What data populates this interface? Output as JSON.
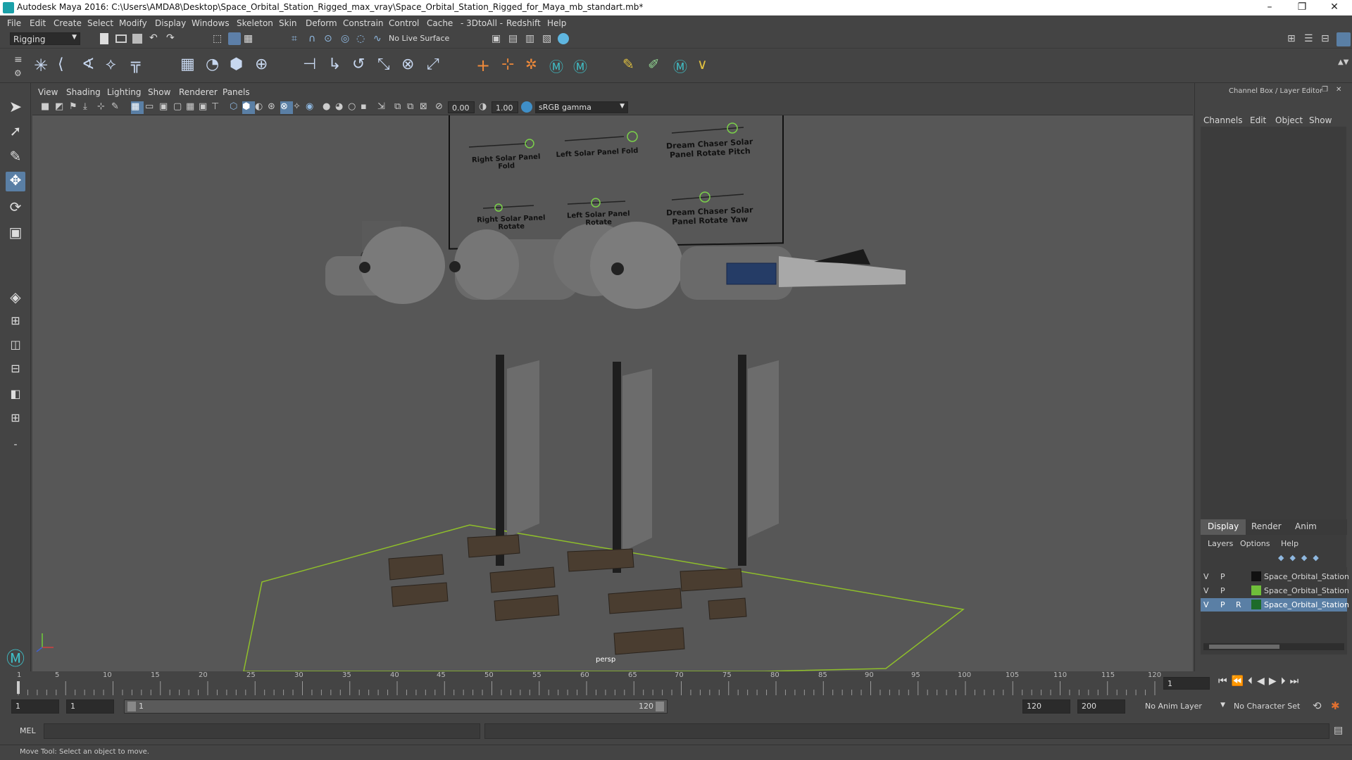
{
  "window": {
    "title": "Autodesk Maya 2016: C:\\Users\\AMDA8\\Desktop\\Space_Orbital_Station_Rigged_max_vray\\Space_Orbital_Station_Rigged_for_Maya_mb_standart.mb*",
    "minimize": "–",
    "restore": "❐",
    "close": "✕"
  },
  "menubar": [
    "File",
    "Edit",
    "Create",
    "Select",
    "Modify",
    "Display",
    "Windows",
    "Skeleton",
    "Skin",
    "Deform",
    "Constrain",
    "Control",
    "Cache",
    "- 3DtoAll -",
    "Redshift",
    "Help"
  ],
  "statusline": {
    "mode": "Rigging",
    "live_surface": "No Live Surface"
  },
  "panel": {
    "menus": [
      "View",
      "Shading",
      "Lighting",
      "Show",
      "Renderer",
      "Panels"
    ],
    "exposure": "0.00",
    "gamma": "1.00",
    "colorspace": "sRGB gamma",
    "camera_label": "persp"
  },
  "controls": {
    "labels": [
      "Right Solar Panel Fold",
      "Left Solar Panel Fold",
      "Dream Chaser Solar Panel Rotate Pitch",
      "Right Solar Panel Rotate",
      "Left Solar Panel Rotate",
      "Dream Chaser Solar Panel Rotate Yaw"
    ]
  },
  "channelbox": {
    "header": "Channel Box / Layer Editor",
    "menus": [
      "Channels",
      "Edit",
      "Object",
      "Show"
    ],
    "tabs": [
      "Display",
      "Render",
      "Anim"
    ],
    "layer_menus": [
      "Layers",
      "Options",
      "Help"
    ],
    "layers": [
      {
        "v": "V",
        "p": "P",
        "r": "",
        "color": "#111111",
        "name": "Space_Orbital_Station",
        "selected": false
      },
      {
        "v": "V",
        "p": "P",
        "r": "",
        "color": "#6fbf3a",
        "name": "Space_Orbital_Station",
        "selected": false
      },
      {
        "v": "V",
        "p": "P",
        "r": "R",
        "color": "#1d6b2a",
        "name": "Space_Orbital_Station",
        "selected": true
      }
    ]
  },
  "timeline": {
    "ticks": [
      "1",
      "5",
      "10",
      "15",
      "20",
      "25",
      "30",
      "35",
      "40",
      "45",
      "50",
      "55",
      "60",
      "65",
      "70",
      "75",
      "80",
      "85",
      "90",
      "95",
      "100",
      "105",
      "110",
      "115",
      "120"
    ],
    "current_frame": "1"
  },
  "range": {
    "start": "1",
    "playback_start": "1",
    "slider_start": "1",
    "slider_end": "120",
    "playback_end": "120",
    "end": "200",
    "anim_layer": "No Anim Layer",
    "character_set": "No Character Set"
  },
  "cmdline": {
    "label": "MEL"
  },
  "helpline": {
    "text": "Move Tool: Select an object to move."
  }
}
